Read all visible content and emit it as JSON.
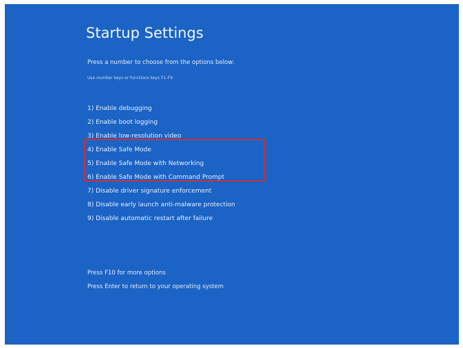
{
  "screen": {
    "title": "Startup Settings",
    "instruction": "Press a number to choose from the options below:",
    "note": "Use number keys or functions keys F1-F9."
  },
  "options": [
    {
      "label": "1) Enable debugging"
    },
    {
      "label": "2) Enable boot logging"
    },
    {
      "label": "3) Enable low-resolution video"
    },
    {
      "label": "4) Enable Safe Mode"
    },
    {
      "label": "5) Enable Safe Mode with Networking"
    },
    {
      "label": "6) Enable Safe Mode with Command Prompt"
    },
    {
      "label": "7) Disable driver signature enforcement"
    },
    {
      "label": "8) Disable early launch anti-malware protection"
    },
    {
      "label": "9) Disable automatic restart after failure"
    }
  ],
  "footer": {
    "more_options": "Press F10 for more options",
    "return": "Press Enter to return to your operating system"
  },
  "colors": {
    "background": "#1b63c4",
    "text": "#e8f0ff",
    "highlight": "#c8323a"
  }
}
